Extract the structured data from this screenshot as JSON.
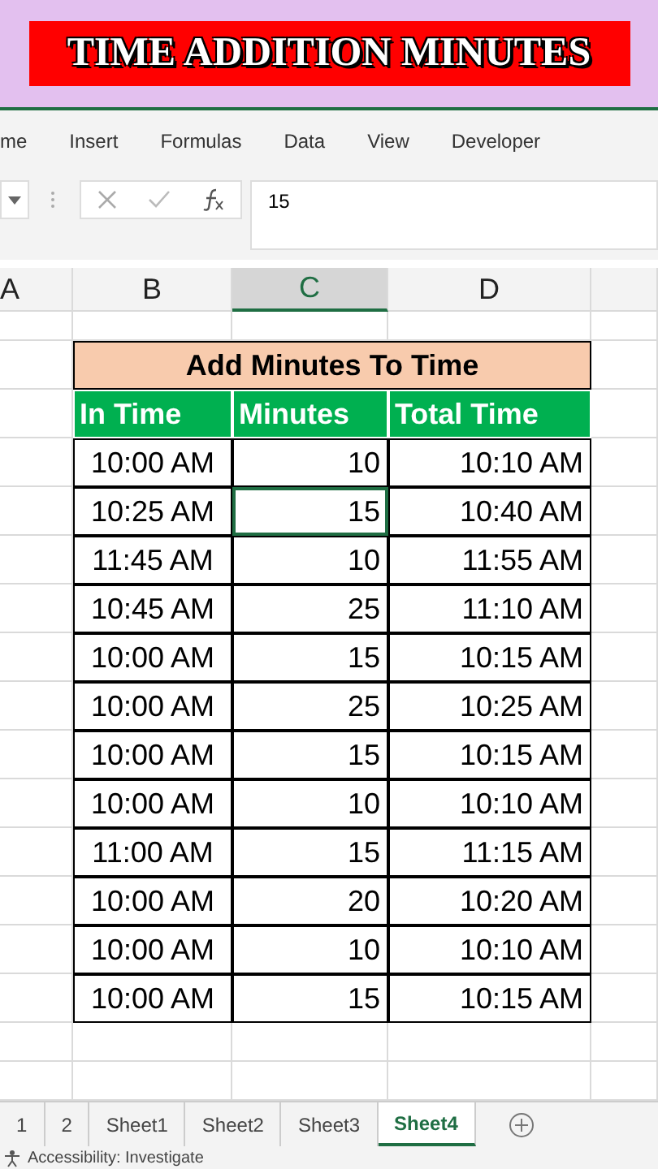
{
  "banner": {
    "title": "TIME ADDITION MINUTES"
  },
  "ribbon_tabs": [
    {
      "label": "me",
      "selected": false
    },
    {
      "label": "Insert",
      "selected": false
    },
    {
      "label": "Formulas",
      "selected": false
    },
    {
      "label": "Data",
      "selected": false
    },
    {
      "label": "View",
      "selected": false
    },
    {
      "label": "Developer",
      "selected": false
    }
  ],
  "formula_bar": {
    "value": "15"
  },
  "columns": [
    {
      "label": "A",
      "selected": false
    },
    {
      "label": "B",
      "selected": false
    },
    {
      "label": "C",
      "selected": true
    },
    {
      "label": "D",
      "selected": false
    }
  ],
  "table": {
    "title": "Add Minutes To Time",
    "headers": [
      "In Time",
      "Minutes",
      "Total Time"
    ],
    "rows": [
      {
        "in_time": "10:00 AM",
        "minutes": "10",
        "total_time": "10:10 AM",
        "selected": false
      },
      {
        "in_time": "10:25 AM",
        "minutes": "15",
        "total_time": "10:40 AM",
        "selected": true
      },
      {
        "in_time": "11:45 AM",
        "minutes": "10",
        "total_time": "11:55 AM",
        "selected": false
      },
      {
        "in_time": "10:45 AM",
        "minutes": "25",
        "total_time": "11:10 AM",
        "selected": false
      },
      {
        "in_time": "10:00 AM",
        "minutes": "15",
        "total_time": "10:15 AM",
        "selected": false
      },
      {
        "in_time": "10:00 AM",
        "minutes": "25",
        "total_time": "10:25 AM",
        "selected": false
      },
      {
        "in_time": "10:00 AM",
        "minutes": "15",
        "total_time": "10:15 AM",
        "selected": false
      },
      {
        "in_time": "10:00 AM",
        "minutes": "10",
        "total_time": "10:10 AM",
        "selected": false
      },
      {
        "in_time": "11:00 AM",
        "minutes": "15",
        "total_time": "11:15 AM",
        "selected": false
      },
      {
        "in_time": "10:00 AM",
        "minutes": "20",
        "total_time": "10:20 AM",
        "selected": false
      },
      {
        "in_time": "10:00 AM",
        "minutes": "10",
        "total_time": "10:10 AM",
        "selected": false
      },
      {
        "in_time": "10:00 AM",
        "minutes": "15",
        "total_time": "10:15 AM",
        "selected": false
      }
    ]
  },
  "sheet_tabs": [
    {
      "label": "1",
      "selected": false
    },
    {
      "label": "2",
      "selected": false
    },
    {
      "label": "Sheet1",
      "selected": false
    },
    {
      "label": "Sheet2",
      "selected": false
    },
    {
      "label": "Sheet3",
      "selected": false
    },
    {
      "label": "Sheet4",
      "selected": true
    }
  ],
  "status_bar": {
    "text": "Accessibility: Investigate"
  }
}
